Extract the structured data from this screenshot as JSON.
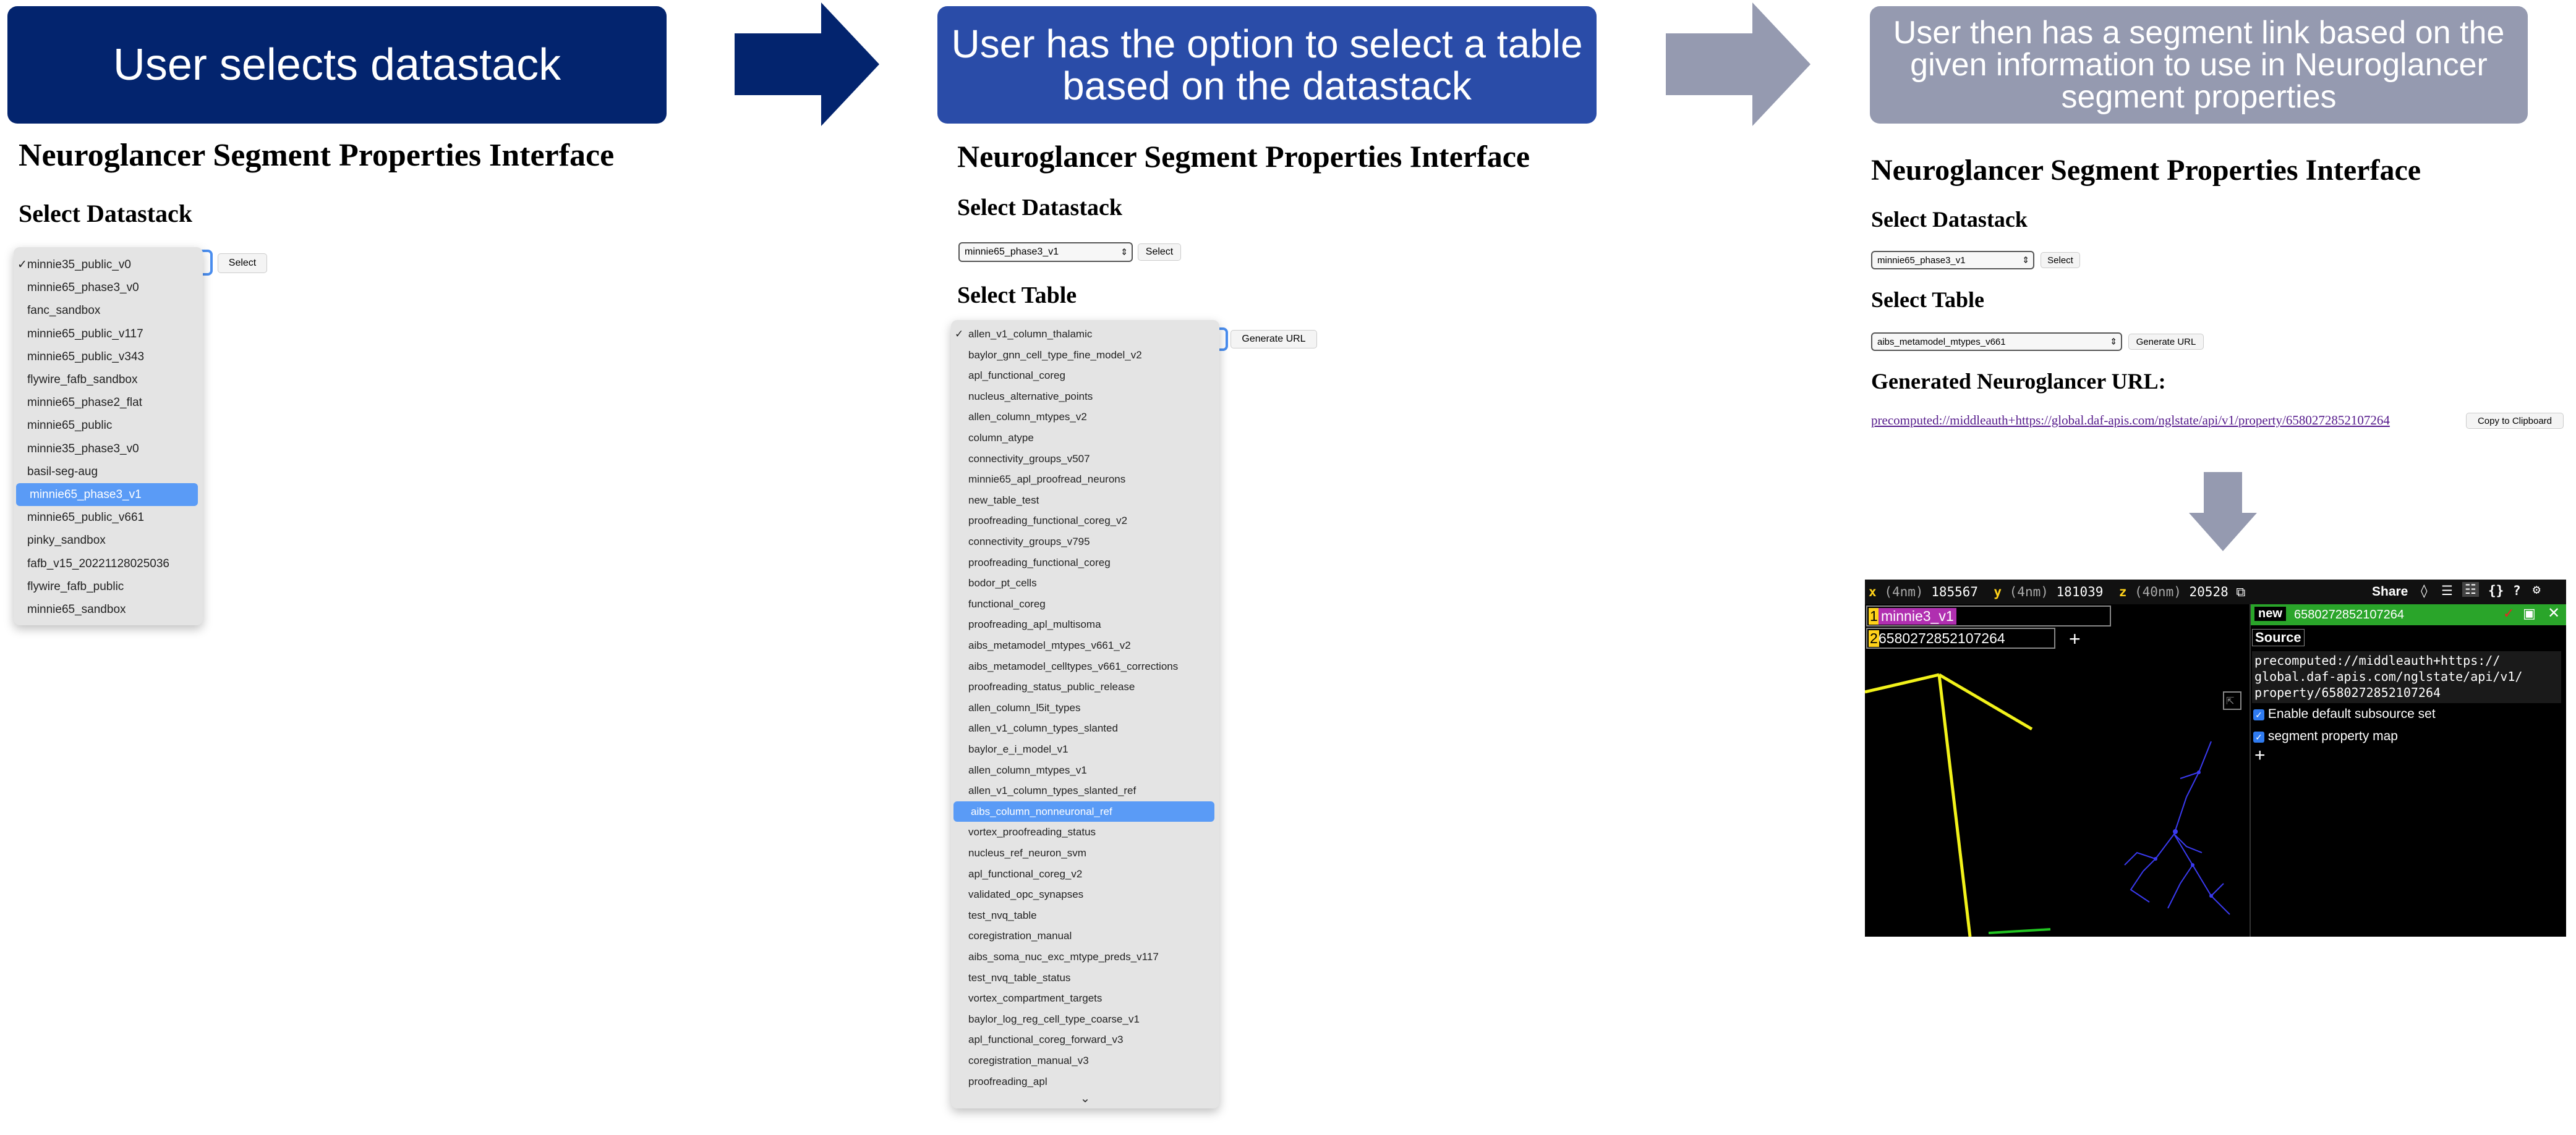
{
  "steps": [
    {
      "banner": "User selects datastack",
      "color": "#03246e"
    },
    {
      "banner_line1": "User has the option to select a table",
      "banner_line2": "based on the datastack",
      "color": "#2a4ca8"
    },
    {
      "banner_line1": "User then has a segment link based on the",
      "banner_line2": "given information to use in Neuroglancer",
      "banner_line3": "segment properties",
      "color": "#959ab0"
    }
  ],
  "app": {
    "title": "Neuroglancer Segment Properties Interface",
    "select_datastack": "Select Datastack",
    "select_table": "Select Table",
    "generated_url_heading": "Generated Neuroglancer URL:",
    "select_button": "Select",
    "generate_button": "Generate URL",
    "copy_button": "Copy to Clipboard"
  },
  "panel1": {
    "datastack_options": [
      "minnie35_public_v0",
      "minnie65_phase3_v0",
      "fanc_sandbox",
      "minnie65_public_v117",
      "minnie65_public_v343",
      "flywire_fafb_sandbox",
      "minnie65_phase2_flat",
      "minnie65_public",
      "minnie35_phase3_v0",
      "basil-seg-aug",
      "minnie65_phase3_v1",
      "minnie65_public_v661",
      "pinky_sandbox",
      "fafb_v15_20221128025036",
      "flywire_fafb_public",
      "minnie65_sandbox"
    ],
    "checked_index": 0,
    "highlighted_index": 10
  },
  "panel2": {
    "datastack_value": "minnie65_phase3_v1",
    "table_options": [
      "allen_v1_column_thalamic",
      "baylor_gnn_cell_type_fine_model_v2",
      "apl_functional_coreg",
      "nucleus_alternative_points",
      "allen_column_mtypes_v2",
      "column_atype",
      "connectivity_groups_v507",
      "minnie65_apl_proofread_neurons",
      "new_table_test",
      "proofreading_functional_coreg_v2",
      "connectivity_groups_v795",
      "proofreading_functional_coreg",
      "bodor_pt_cells",
      "functional_coreg",
      "proofreading_apl_multisoma",
      "aibs_metamodel_mtypes_v661_v2",
      "aibs_metamodel_celltypes_v661_corrections",
      "proofreading_status_public_release",
      "allen_column_l5it_types",
      "allen_v1_column_types_slanted",
      "baylor_e_i_model_v1",
      "allen_column_mtypes_v1",
      "allen_v1_column_types_slanted_ref",
      "aibs_column_nonneuronal_ref",
      "vortex_proofreading_status",
      "nucleus_ref_neuron_svm",
      "apl_functional_coreg_v2",
      "validated_opc_synapses",
      "test_nvq_table",
      "coregistration_manual",
      "aibs_soma_nuc_exc_mtype_preds_v117",
      "test_nvq_table_status",
      "vortex_compartment_targets",
      "baylor_log_reg_cell_type_coarse_v1",
      "apl_functional_coreg_forward_v3",
      "coregistration_manual_v3",
      "proofreading_apl"
    ],
    "checked_index": 0,
    "highlighted_index": 23
  },
  "panel3": {
    "datastack_value": "minnie65_phase3_v1",
    "table_value": "aibs_metamodel_mtypes_v661",
    "url": "precomputed://middleauth+https://global.daf-apis.com/nglstate/api/v1/property/6580272852107264"
  },
  "viewer": {
    "x_label": "x",
    "x_unit": "(4nm)",
    "x_value": "185567",
    "y_label": "y",
    "y_unit": "(4nm)",
    "y_value": "181039",
    "z_label": "z",
    "z_unit": "(40nm)",
    "z_value": "20528",
    "share_label": "Share",
    "layer1_num": "1",
    "layer1_name": "minnie3_v1",
    "layer2_num": "2",
    "layer2_name": "6580272852107264",
    "panel_badge": "new",
    "panel_id": "6580272852107264",
    "source_tab": "Source",
    "source_line1": "precomputed://middleauth+https://",
    "source_line2": "global.daf-apis.com/nglstate/api/v1/",
    "source_line3": "property/6580272852107264",
    "enable_subsource": "Enable default subsource set",
    "segment_map": "segment property map",
    "plus": "+"
  },
  "colors": {
    "yellow_line": "#f2f21a",
    "neuron": "#3a3af0",
    "panel_green": "#2aa52a",
    "magenta_chip": "#b02fb0"
  }
}
